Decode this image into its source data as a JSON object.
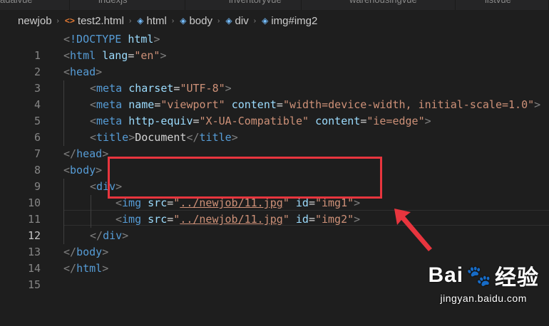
{
  "tabs": [
    {
      "label": "adaivue"
    },
    {
      "label": "indexjs"
    },
    {
      "label": "inventoryvue"
    },
    {
      "label": "warehousingvue"
    },
    {
      "label": "listvue"
    }
  ],
  "breadcrumb": {
    "items": [
      {
        "label": "newjob",
        "icon": ""
      },
      {
        "label": "test2.html",
        "icon": "html-file-icon"
      },
      {
        "label": "html",
        "icon": "cube-icon"
      },
      {
        "label": "body",
        "icon": "cube-icon"
      },
      {
        "label": "div",
        "icon": "cube-icon"
      },
      {
        "label": "img#img2",
        "icon": "cube-icon"
      }
    ],
    "separator": "›"
  },
  "editor": {
    "active_line": 12,
    "lines": [
      {
        "n": "1"
      },
      {
        "n": "2"
      },
      {
        "n": "3"
      },
      {
        "n": "4"
      },
      {
        "n": "5"
      },
      {
        "n": "6"
      },
      {
        "n": "7"
      },
      {
        "n": "8"
      },
      {
        "n": "9"
      },
      {
        "n": "10"
      },
      {
        "n": "11"
      },
      {
        "n": "12"
      },
      {
        "n": "13"
      },
      {
        "n": "14"
      },
      {
        "n": "15"
      }
    ],
    "tokens": {
      "l1_doctype": "!DOCTYPE",
      "l1_html": "html",
      "l2_tag": "html",
      "l2_attr": "lang",
      "l2_val": "\"en\"",
      "l3_tag": "head",
      "l4_tag": "meta",
      "l4_attr": "charset",
      "l4_val": "\"UTF-8\"",
      "l5_tag": "meta",
      "l5_attr1": "name",
      "l5_val1": "\"viewport\"",
      "l5_attr2": "content",
      "l5_val2": "\"width=device-width, initial-scale=1.0\"",
      "l6_tag": "meta",
      "l6_attr1": "http-equiv",
      "l6_val1": "\"X-UA-Compatible\"",
      "l6_attr2": "content",
      "l6_val2": "\"ie=edge\"",
      "l7_tag": "title",
      "l7_text": "Document",
      "l7_close": "title",
      "l8_tag": "head",
      "l9_tag": "body",
      "l10_tag": "div",
      "l11_tag": "img",
      "l11_attr1": "src",
      "l11_val1_q": "\"",
      "l11_val1": "../newjob/11.jpg",
      "l11_attr2": "id",
      "l11_val2": "\"img1\"",
      "l12_tag": "img",
      "l12_attr1": "src",
      "l12_val1_q": "\"",
      "l12_val1": "../newjob/11.jpg",
      "l12_attr2": "id",
      "l12_val2": "\"img2\"",
      "l13_tag": "div",
      "l14_tag": "body",
      "l15_tag": "html"
    }
  },
  "annotation": {
    "color": "#e8353e"
  },
  "watermark": {
    "logo_text": "Bai",
    "logo_text2": "经验",
    "url": "jingyan.baidu.com"
  }
}
